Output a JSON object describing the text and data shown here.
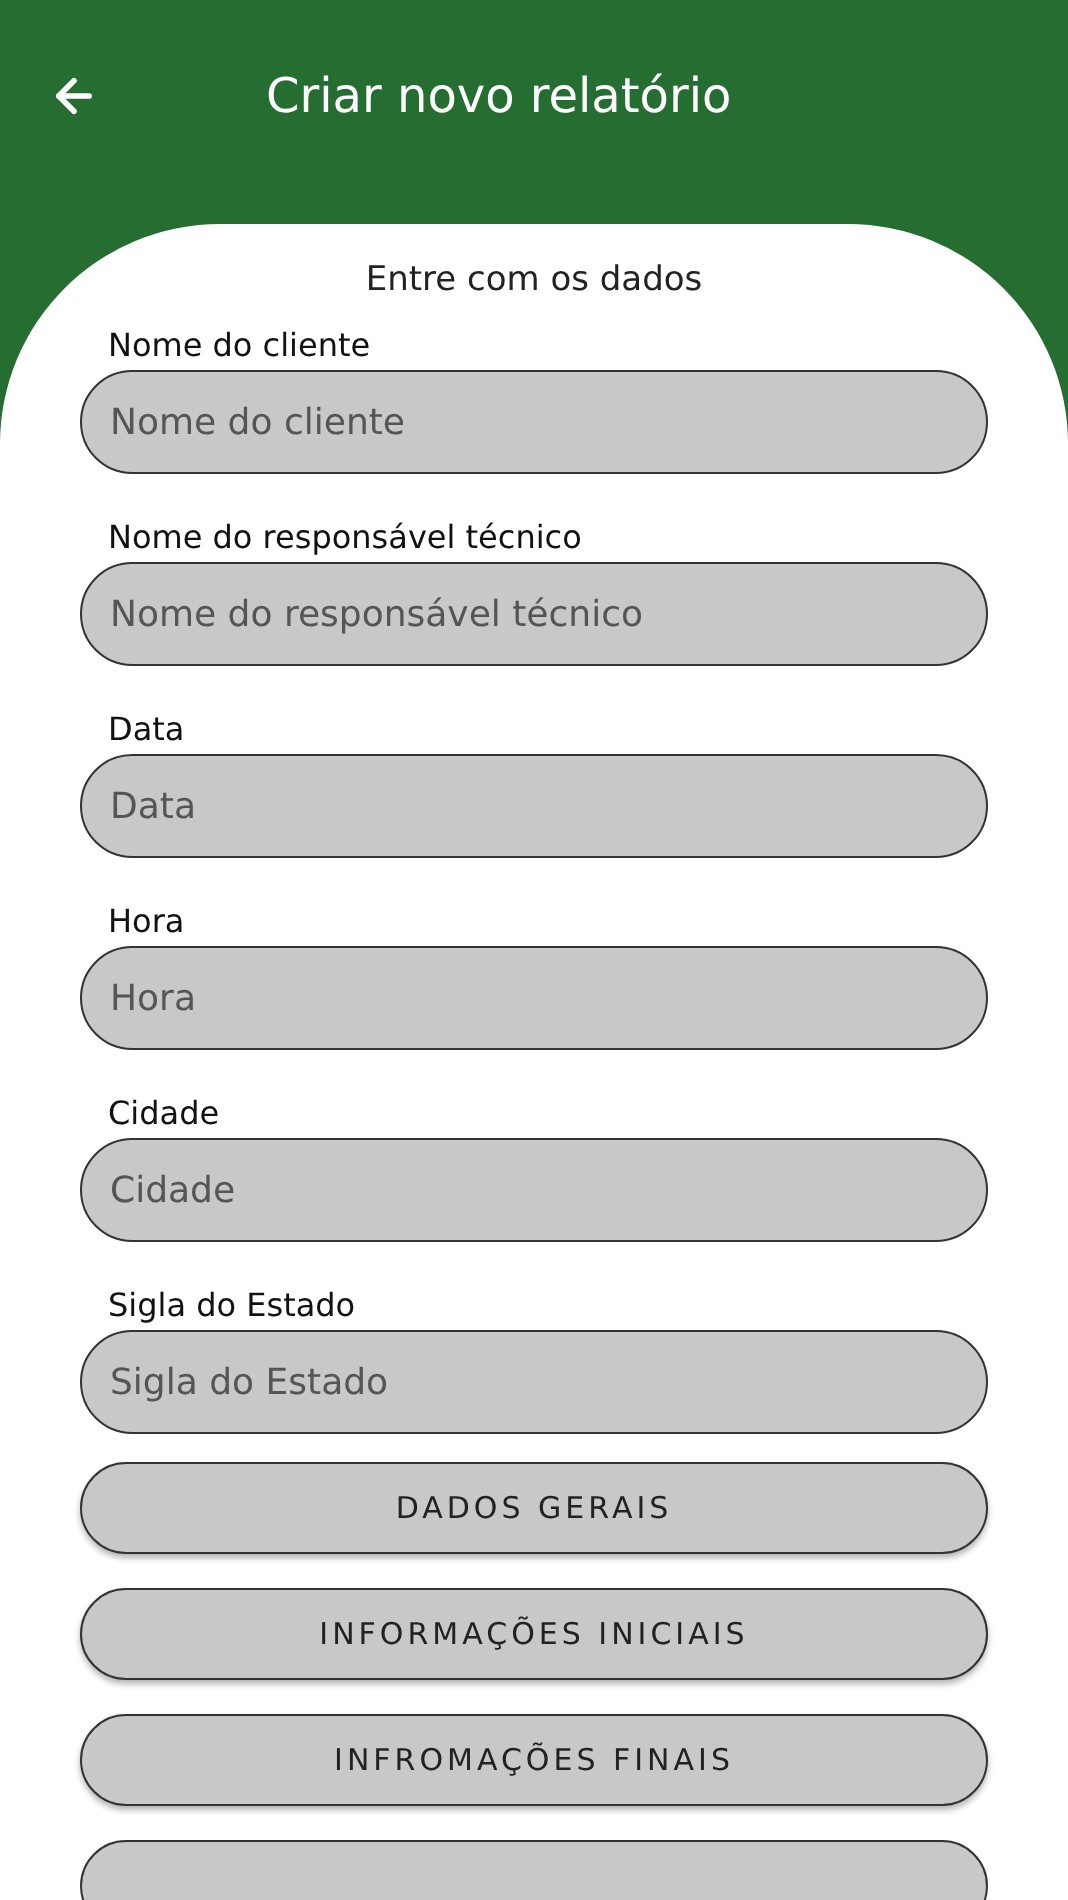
{
  "app_bar": {
    "title": "Criar novo relatório"
  },
  "form": {
    "heading": "Entre com os dados",
    "fields": [
      {
        "label": "Nome do cliente",
        "placeholder": "Nome do cliente"
      },
      {
        "label": "Nome do responsável técnico",
        "placeholder": "Nome do responsável técnico"
      },
      {
        "label": "Data",
        "placeholder": "Data"
      },
      {
        "label": "Hora",
        "placeholder": "Hora"
      },
      {
        "label": "Cidade",
        "placeholder": "Cidade"
      },
      {
        "label": "Sigla do Estado",
        "placeholder": "Sigla do Estado"
      }
    ],
    "buttons": [
      "DADOS GERAIS",
      "INFORMAÇÕES INICIAIS",
      "INFROMAÇÕES FINAIS"
    ]
  }
}
